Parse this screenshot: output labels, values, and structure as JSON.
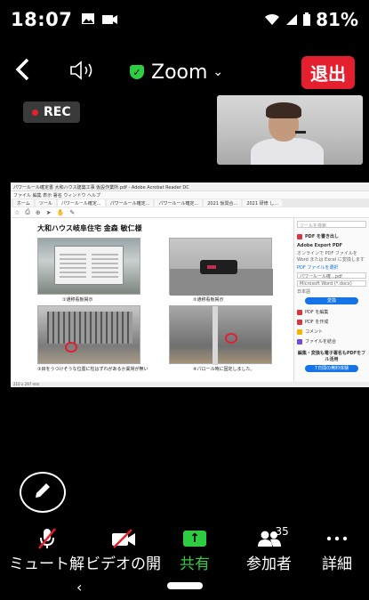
{
  "status": {
    "time": "18:07",
    "battery": "81%"
  },
  "meeting": {
    "title": "Zoom",
    "leave_label": "退出",
    "rec_label": "REC"
  },
  "shared_doc": {
    "window_title": "パワールール確定書 大和ハウス建築工事 仮設作業所.pdf - Adobe Acrobat Reader DC",
    "menu": "ファイル 編集 表示 署名 ウィンドウ ヘルプ",
    "tabs": [
      "ホーム",
      "ツール",
      "パワールール確定...",
      "パワールール確定...",
      "パワールール確定...",
      "2021 仮問合...",
      "2021 研修 し..."
    ],
    "heading": "大和ハウス岐阜住宅 金森 敏仁様",
    "captions": [
      "①通称看板掲示",
      "②通称看板掲示",
      "③目をうつけそうな位置に柱はずれがあるか異常が無い",
      "④パロール時に固定しました。"
    ],
    "side_panel": {
      "search": "ツールを検索",
      "export_title": "PDF を書き出し",
      "export_heading": "Adobe Export PDF",
      "export_desc": "オンラインで PDF ファイルを Word または Excel に変換します",
      "select_file": "PDF ファイルを選択",
      "file_name": "パワールール確...pdf",
      "format": "Microsoft Word (*.docx)",
      "language": "日本語",
      "convert_btn": "変換",
      "tools": [
        "PDF を編集",
        "PDF を作成",
        "コメント",
        "ファイルを結合"
      ],
      "promo": "編集・変換も電子署名もPDFをフル活用",
      "trial_btn": "7日間の無料体験"
    },
    "statusbar": "210 x 297 mm"
  },
  "toolbar": {
    "mute_label": "ミュート解",
    "video_label": "ビデオの開",
    "share_label": "共有",
    "participants_label": "参加者",
    "participants_count": "35",
    "more_label": "詳細"
  },
  "icons": [
    "image-icon",
    "video-camera-icon",
    "signal-icon",
    "battery-icon",
    "back-arrow-icon",
    "speaker-icon",
    "shield-check-icon",
    "chevron-down-icon",
    "pencil-icon",
    "mic-off-icon",
    "video-off-icon",
    "share-up-arrow-icon",
    "participants-icon",
    "more-dots-icon"
  ],
  "colors": {
    "share_green": "#2ecc40",
    "leave_red": "#e5202e"
  }
}
